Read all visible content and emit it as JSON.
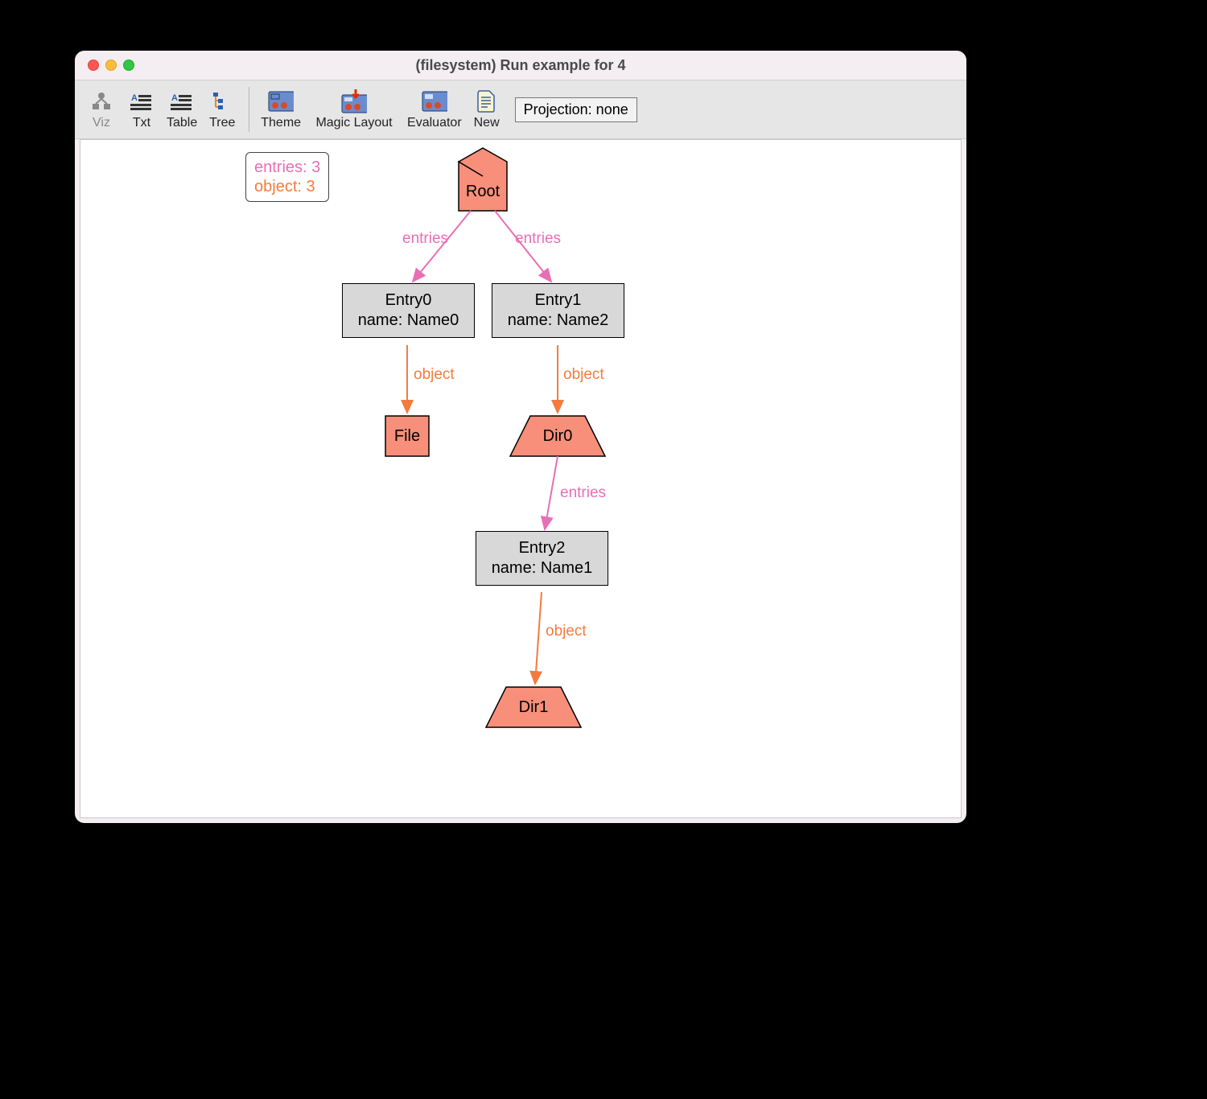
{
  "window": {
    "title": "(filesystem) Run example for 4"
  },
  "toolbar": {
    "viz": "Viz",
    "txt": "Txt",
    "table": "Table",
    "tree": "Tree",
    "theme": "Theme",
    "magic": "Magic Layout",
    "evaluator": "Evaluator",
    "new": "New",
    "projection": "Projection: none"
  },
  "legend": {
    "entries": "entries: 3",
    "object": "object: 3"
  },
  "nodes": {
    "root": {
      "label": "Root"
    },
    "entry0": {
      "line1": "Entry0",
      "line2": "name: Name0"
    },
    "entry1": {
      "line1": "Entry1",
      "line2": "name: Name2"
    },
    "file": {
      "label": "File"
    },
    "dir0": {
      "label": "Dir0"
    },
    "entry2": {
      "line1": "Entry2",
      "line2": "name: Name1"
    },
    "dir1": {
      "label": "Dir1"
    }
  },
  "edges": {
    "root_e0": "entries",
    "root_e1": "entries",
    "e0_file": "object",
    "e1_dir0": "object",
    "dir0_e2": "entries",
    "e2_dir1": "object"
  }
}
